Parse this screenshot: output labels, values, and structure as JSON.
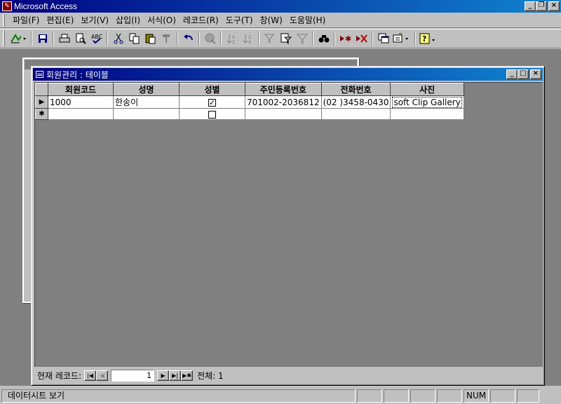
{
  "app": {
    "title": "Microsoft Access"
  },
  "title_buttons": {
    "minimize": "_",
    "restore": "❐",
    "close": "×"
  },
  "menu": [
    "파일(F)",
    "편집(E)",
    "보기(V)",
    "삽입(I)",
    "서식(O)",
    "레코드(R)",
    "도구(T)",
    "창(W)",
    "도움말(H)"
  ],
  "toolbar": {
    "icons": [
      "view-design-icon",
      "save-icon",
      "print-icon",
      "print-preview-icon",
      "spelling-icon",
      "cut-icon",
      "copy-icon",
      "paste-icon",
      "format-painter-icon",
      "undo-icon",
      "hyperlink-icon",
      "sort-ascending-icon",
      "sort-descending-icon",
      "filter-by-selection-icon",
      "filter-by-form-icon",
      "apply-filter-icon",
      "find-icon",
      "new-record-icon",
      "delete-record-icon",
      "database-window-icon",
      "new-object-icon",
      "help-icon"
    ]
  },
  "table_window": {
    "title": "회원관리 : 테이블",
    "columns": [
      "회원코드",
      "성명",
      "성별",
      "주민등록번호",
      "전화번호",
      "사진"
    ],
    "rows": [
      {
        "selector": "▶",
        "code": "1000",
        "name": "한송이",
        "gender_checked": true,
        "ssn": "701002-2036812",
        "phone": "(02  )3458-0430",
        "photo": "soft Clip Gallery"
      },
      {
        "selector": "✱",
        "code": "",
        "name": "",
        "gender_checked": false,
        "ssn": "",
        "phone": "",
        "photo": ""
      }
    ]
  },
  "record_nav": {
    "label": "현재 레코드:",
    "current": "1",
    "total_label": "전체: 1",
    "first": "|◀",
    "prev": "◀",
    "next": "▶",
    "last": "▶|",
    "new": "▶✱"
  },
  "statusbar": {
    "text": "데이터시트 보기",
    "num": "NUM"
  }
}
